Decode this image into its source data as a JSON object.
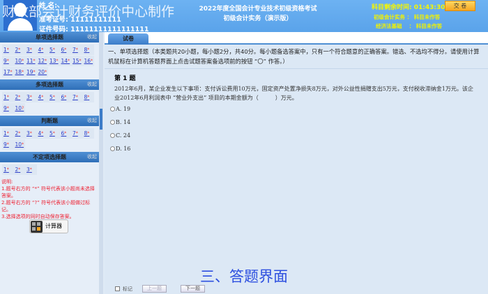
{
  "header": {
    "name_label": "姓    名:",
    "id_label": "准考证号:",
    "id_value": "11111111111",
    "cert_label": "证件号码:",
    "cert_value": "11111111111111111",
    "watermark": "财政部会计财务评价中心制作",
    "title1": "2022年度全国会计专业技术初级资格考试",
    "title2": "初级会计实务（演示版）",
    "timer_label": "科目剩余时间:",
    "timer": "01:43:30",
    "submit": "交 卷",
    "subjects": [
      {
        "name": "初级会计实务",
        "status": "科目未作答"
      },
      {
        "name": "经济法基础",
        "status": "科目未作答"
      }
    ]
  },
  "sidebar": {
    "collapse": "收起",
    "sections": [
      {
        "title": "单项选择题",
        "items": [
          "1",
          "2",
          "3",
          "4",
          "5",
          "6",
          "7",
          "8",
          "9",
          "10",
          "11",
          "12",
          "13",
          "14",
          "15",
          "16",
          "17",
          "18",
          "19",
          "20"
        ],
        "marks": [
          "*",
          "*",
          "*",
          "*",
          "*",
          "*",
          "*",
          "*",
          "*",
          "*",
          "*",
          "*",
          "*",
          "*",
          "*",
          "*",
          "*",
          "*",
          "*",
          "*"
        ]
      },
      {
        "title": "多项选择题",
        "items": [
          "1",
          "2",
          "3",
          "4",
          "5",
          "6",
          "7",
          "8",
          "9",
          "10"
        ],
        "marks": [
          "*",
          "*",
          "*",
          "*",
          "*",
          "*",
          "*",
          "*",
          "*",
          "?"
        ]
      },
      {
        "title": "判断题",
        "items": [
          "1",
          "2",
          "3",
          "4",
          "5",
          "6",
          "7",
          "8",
          "9",
          "10"
        ],
        "marks": [
          "*",
          "*",
          "*",
          "*",
          "*",
          "*",
          "*",
          "*",
          "*",
          "*"
        ]
      },
      {
        "title": "不定项选择题",
        "items": [
          "1",
          "2",
          "3"
        ],
        "marks": [
          "*",
          "*",
          "*"
        ]
      }
    ],
    "notes": [
      "说明:",
      "1.题号右方的 “*” 符号代表该小题尚未选择答案。",
      "2.题号右方的 “?” 符号代表该小题做过标记。",
      "3.选择选项的同时自动保存答案。"
    ],
    "calculator": "计算器"
  },
  "main": {
    "tab": "试卷",
    "intro": "一、单项选择题（本类题共20小题，每小题2分，共40分。每小题备选答案中，只有一个符合题意的正确答案。错选、不选均不得分。请使用计算机鼠标在计算机答题界面上点击试题答案备选项前的按钮 “〇” 作答。）",
    "qnum": "第 1 题",
    "question": "2012年6月，某企业发生以下事项：支付诉讼费用10万元，固定资产处置净损失8万元，对外公益性捐赠支出5万元，支付税收滞纳金1万元。该企业2012年6月利润表中 “营业外支出” 项目的本期金额为（　　　）万元。",
    "options": [
      "A. 19",
      "B. 14",
      "C. 24",
      "D. 16"
    ],
    "mark": "标记",
    "prev": "上一题",
    "next": "下一题"
  },
  "caption": "三、答题界面"
}
